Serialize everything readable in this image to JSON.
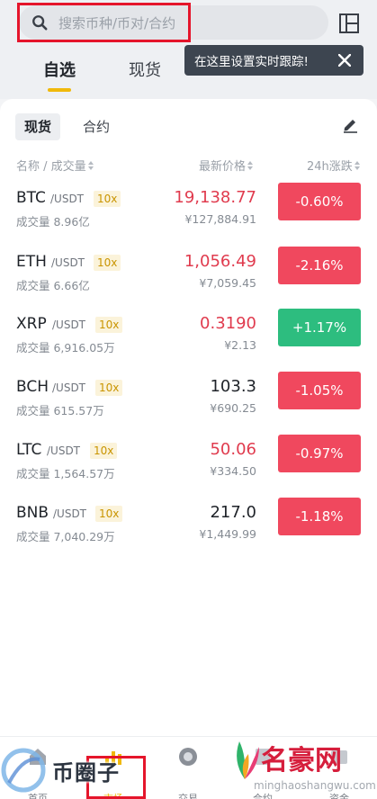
{
  "search": {
    "placeholder": "搜索币种/币对/合约"
  },
  "top_tabs": [
    "自选",
    "现货"
  ],
  "tooltip": {
    "text": "在这里设置实时跟踪!"
  },
  "segments": [
    "现货",
    "合约"
  ],
  "columns": {
    "name": "名称 / 成交量",
    "price": "最新价格",
    "change": "24h涨跌"
  },
  "rows": [
    {
      "symbol": "BTC",
      "quote": "/USDT",
      "leverage": "10x",
      "volume": "成交量 8.96亿",
      "price": "19,138.77",
      "cny": "¥127,884.91",
      "change": "-0.60%",
      "direction": "down",
      "price_color": "red"
    },
    {
      "symbol": "ETH",
      "quote": "/USDT",
      "leverage": "10x",
      "volume": "成交量 6.66亿",
      "price": "1,056.49",
      "cny": "¥7,059.45",
      "change": "-2.16%",
      "direction": "down",
      "price_color": "red"
    },
    {
      "symbol": "XRP",
      "quote": "/USDT",
      "leverage": "10x",
      "volume": "成交量 6,916.05万",
      "price": "0.3190",
      "cny": "¥2.13",
      "change": "+1.17%",
      "direction": "up",
      "price_color": "red"
    },
    {
      "symbol": "BCH",
      "quote": "/USDT",
      "leverage": "10x",
      "volume": "成交量 615.57万",
      "price": "103.3",
      "cny": "¥690.25",
      "change": "-1.05%",
      "direction": "down",
      "price_color": "black"
    },
    {
      "symbol": "LTC",
      "quote": "/USDT",
      "leverage": "10x",
      "volume": "成交量 1,564.57万",
      "price": "50.06",
      "cny": "¥334.50",
      "change": "-0.97%",
      "direction": "down",
      "price_color": "red"
    },
    {
      "symbol": "BNB",
      "quote": "/USDT",
      "leverage": "10x",
      "volume": "成交量 7,040.29万",
      "price": "217.0",
      "cny": "¥1,449.99",
      "change": "-1.18%",
      "direction": "down",
      "price_color": "black"
    }
  ],
  "bottom_nav": [
    {
      "label": "首页",
      "icon": "home-icon"
    },
    {
      "label": "市场",
      "icon": "market-icon",
      "active": true
    },
    {
      "label": "交易",
      "icon": "trade-icon"
    },
    {
      "label": "合约",
      "icon": "contract-icon"
    },
    {
      "label": "资金",
      "icon": "wallet-icon"
    }
  ],
  "watermarks": {
    "left": "币圈子",
    "right_brand": "名豪网",
    "right_url": "minghaoshangwu.com"
  },
  "colors": {
    "accent": "#f0b90b",
    "down": "#f0485e",
    "up": "#2dbd7f",
    "price_red": "#e03b4e",
    "highlight_box": "#e5152b"
  }
}
